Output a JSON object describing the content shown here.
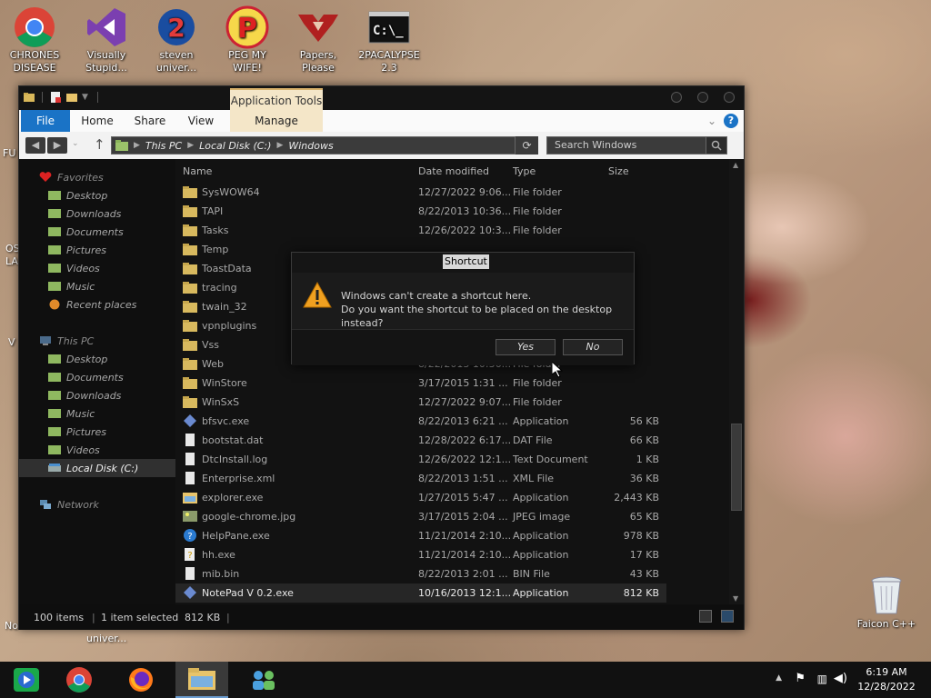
{
  "desktop": {
    "icons": [
      {
        "label": "CHRONES DISEASE",
        "icon": "chrome-icon"
      },
      {
        "label": "Visually Stupid...",
        "icon": "visual-studio-icon"
      },
      {
        "label": "steven univer...",
        "icon": "steam-icon"
      },
      {
        "label": "PEG MY WIFE!",
        "icon": "peggle-icon"
      },
      {
        "label": "Papers, Please",
        "icon": "papers-please-icon"
      },
      {
        "label": "2PACALYPSE 2.3",
        "icon": "terminal-icon"
      }
    ],
    "edge_labels": [
      "FU",
      "OS LA",
      "V",
      "No"
    ],
    "recycle_bin": {
      "label": "Faicon C++",
      "icon": "recycle-bin-icon"
    },
    "under_window_label": "univer..."
  },
  "explorer": {
    "context_tab": "Application Tools",
    "ribbon_tabs": [
      "File",
      "Home",
      "Share",
      "View",
      "Manage"
    ],
    "address": {
      "crumbs": [
        "This PC",
        "Local Disk (C:)",
        "Windows"
      ]
    },
    "search": {
      "placeholder": "Search Windows"
    },
    "nav": {
      "favorites_label": "Favorites",
      "favorites": [
        "Desktop",
        "Downloads",
        "Documents",
        "Pictures",
        "Videos",
        "Music",
        "Recent places"
      ],
      "thispc_label": "This PC",
      "thispc": [
        "Desktop",
        "Documents",
        "Downloads",
        "Music",
        "Pictures",
        "Videos",
        "Local Disk (C:)"
      ],
      "network_label": "Network"
    },
    "columns": {
      "name": "Name",
      "date": "Date modified",
      "type": "Type",
      "size": "Size"
    },
    "files": [
      {
        "name": "SysWOW64",
        "date": "12/27/2022 9:06...",
        "type": "File folder",
        "size": "",
        "icon": "folder-icon"
      },
      {
        "name": "TAPI",
        "date": "8/22/2013 10:36...",
        "type": "File folder",
        "size": "",
        "icon": "folder-icon"
      },
      {
        "name": "Tasks",
        "date": "12/26/2022 10:3...",
        "type": "File folder",
        "size": "",
        "icon": "folder-icon"
      },
      {
        "name": "Temp",
        "date": "",
        "type": "",
        "size": "",
        "icon": "folder-icon"
      },
      {
        "name": "ToastData",
        "date": "",
        "type": "",
        "size": "",
        "icon": "folder-icon"
      },
      {
        "name": "tracing",
        "date": "",
        "type": "",
        "size": "",
        "icon": "folder-icon"
      },
      {
        "name": "twain_32",
        "date": "",
        "type": "",
        "size": "",
        "icon": "folder-icon"
      },
      {
        "name": "vpnplugins",
        "date": "",
        "type": "",
        "size": "",
        "icon": "folder-icon"
      },
      {
        "name": "Vss",
        "date": "",
        "type": "",
        "size": "",
        "icon": "folder-icon"
      },
      {
        "name": "Web",
        "date": "8/22/2013 10:36...",
        "type": "File folder",
        "size": "",
        "icon": "folder-icon"
      },
      {
        "name": "WinStore",
        "date": "3/17/2015 1:31 ...",
        "type": "File folder",
        "size": "",
        "icon": "folder-icon"
      },
      {
        "name": "WinSxS",
        "date": "12/27/2022 9:07...",
        "type": "File folder",
        "size": "",
        "icon": "folder-icon"
      },
      {
        "name": "bfsvc.exe",
        "date": "8/22/2013 6:21 ...",
        "type": "Application",
        "size": "56 KB",
        "icon": "exe-icon"
      },
      {
        "name": "bootstat.dat",
        "date": "12/28/2022 6:17...",
        "type": "DAT File",
        "size": "66 KB",
        "icon": "file-icon"
      },
      {
        "name": "DtcInstall.log",
        "date": "12/26/2022 12:1...",
        "type": "Text Document",
        "size": "1 KB",
        "icon": "file-icon"
      },
      {
        "name": "Enterprise.xml",
        "date": "8/22/2013 1:51 ...",
        "type": "XML File",
        "size": "36 KB",
        "icon": "file-icon"
      },
      {
        "name": "explorer.exe",
        "date": "1/27/2015 5:47 ...",
        "type": "Application",
        "size": "2,443 KB",
        "icon": "explorer-icon"
      },
      {
        "name": "google-chrome.jpg",
        "date": "3/17/2015 2:04 ...",
        "type": "JPEG image",
        "size": "65 KB",
        "icon": "image-icon"
      },
      {
        "name": "HelpPane.exe",
        "date": "11/21/2014 2:10...",
        "type": "Application",
        "size": "978 KB",
        "icon": "help-icon"
      },
      {
        "name": "hh.exe",
        "date": "11/21/2014 2:10...",
        "type": "Application",
        "size": "17 KB",
        "icon": "help-file-icon"
      },
      {
        "name": "mib.bin",
        "date": "8/22/2013 2:01 ...",
        "type": "BIN File",
        "size": "43 KB",
        "icon": "file-icon"
      },
      {
        "name": "NotePad V 0.2.exe",
        "date": "10/16/2013 12:1...",
        "type": "Application",
        "size": "812 KB",
        "icon": "exe-icon"
      }
    ],
    "status": {
      "count": "100 items",
      "selected": "1 item selected",
      "size": "812 KB"
    }
  },
  "dialog": {
    "title": "Shortcut",
    "line1": "Windows can't create a shortcut here.",
    "line2": "Do you want the shortcut to be placed on the desktop instead?",
    "yes": "Yes",
    "no": "No"
  },
  "taskbar": {
    "items": [
      "media-center-icon",
      "chrome-icon",
      "firefox-icon",
      "file-explorer-icon",
      "network-people-icon"
    ],
    "clock": {
      "time": "6:19 AM",
      "date": "12/28/2022"
    }
  }
}
